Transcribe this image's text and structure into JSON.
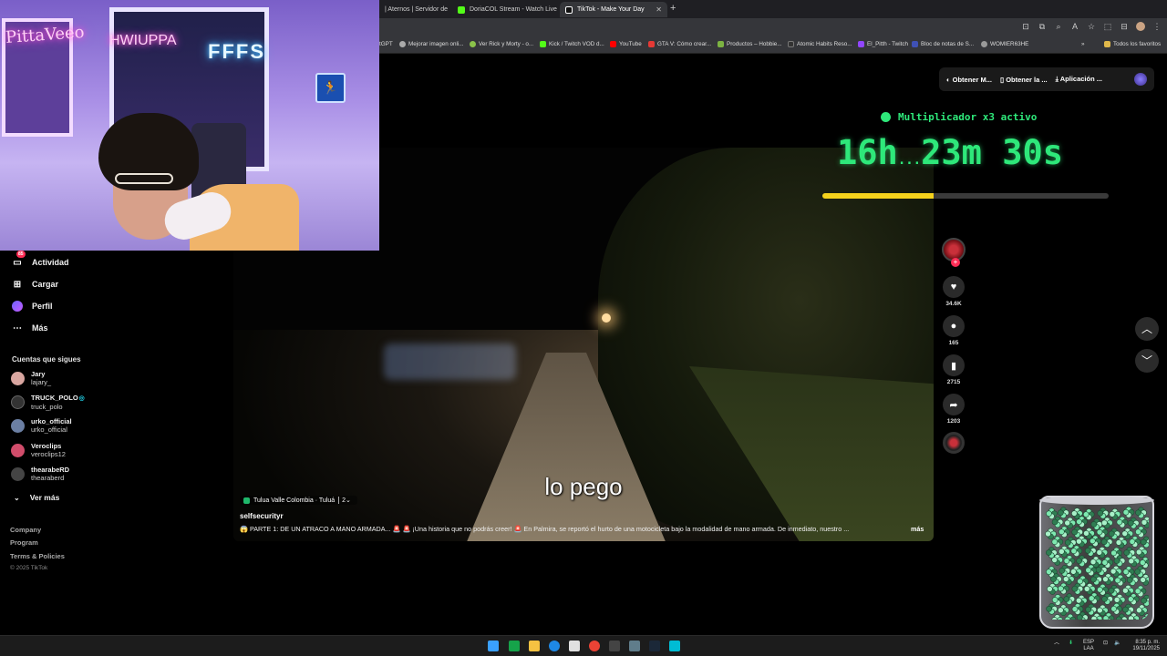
{
  "browser": {
    "tabs": [
      {
        "label": "| Aternos | Servidor de",
        "color": "#2c7be5",
        "active": false
      },
      {
        "label": "DoriaCOL Stream - Watch Live",
        "color": "#53fc18",
        "active": false
      },
      {
        "label": "TikTok - Make Your Day",
        "color": "#111111",
        "active": true
      }
    ],
    "new_tab": "+",
    "bookmarks": [
      {
        "label": "tGPT",
        "color": "#777777"
      },
      {
        "label": "Mejorar imagen onli...",
        "color": "#aaaaaa"
      },
      {
        "label": "Ver Rick y Morty - o...",
        "color": "#8bc34a"
      },
      {
        "label": "Kick / Twitch VOD d...",
        "color": "#53fc18"
      },
      {
        "label": "YouTube",
        "color": "#ff0000"
      },
      {
        "label": "GTA V: Cómo crear...",
        "color": "#e53935"
      },
      {
        "label": "Productos – Hobbie...",
        "color": "#7cb342"
      },
      {
        "label": "Atomic Habits Reso...",
        "color": "#333333"
      },
      {
        "label": "El_Pitth - Twitch",
        "color": "#9146ff"
      },
      {
        "label": "Bloc de notas de S...",
        "color": "#3f51b5"
      },
      {
        "label": "WOMIER63HE",
        "color": "#999999"
      },
      {
        "label": "Todos los favoritos",
        "color": "#e0b84b"
      }
    ]
  },
  "webcam": {
    "neon_left": "PittaVeeo",
    "neon_mid": "HWIUPPA",
    "neon_blue": "FFFS"
  },
  "sidebar": {
    "nav": [
      {
        "label": "Actividad",
        "icon": "activity-icon",
        "badge": "85"
      },
      {
        "label": "Cargar",
        "icon": "upload-icon"
      },
      {
        "label": "Perfil",
        "icon": "profile-icon"
      },
      {
        "label": "Más",
        "icon": "more-icon"
      }
    ],
    "following_title": "Cuentas que sigues",
    "following": [
      {
        "name": "Jary",
        "handle": "lajary_",
        "color": "#d9a6a0"
      },
      {
        "name": "TRUCK_POLO",
        "handle": "truck_polo",
        "color": "#333333",
        "verified": true
      },
      {
        "name": "urko_official",
        "handle": "urko_official",
        "color": "#6b7fa3"
      },
      {
        "name": "Veroclips",
        "handle": "veroclips12",
        "color": "#d14d6b"
      },
      {
        "name": "thearabeRD",
        "handle": "thearaberd",
        "color": "#444444"
      }
    ],
    "see_more": "Ver más",
    "footer": [
      "Company",
      "Program",
      "Terms & Policies"
    ],
    "copyright": "© 2025 TikTok"
  },
  "video": {
    "subtitle": "lo pego",
    "location": "Tulua Valle Colombia · Tuluá",
    "location_count": "2",
    "author": "selfsecurityr",
    "description": "😱 PARTE 1: DE UN ATRACO A MANO ARMADA... 🚨 🚨 ¡Una historia que no podrás creer! 🚨 En Palmira, se reportó el hurto de una motocicleta bajo la modalidad de mano armada. De inmediato, nuestro ...",
    "more": "más"
  },
  "actions": {
    "likes": "34.6K",
    "comments": "165",
    "saves": "2715",
    "shares": "1203"
  },
  "app_bar": {
    "btn1": "Obtener M...",
    "btn2": "Obtener la ...",
    "btn3": "Aplicación ..."
  },
  "stream_overlay": {
    "multiplier": "Multiplicador x3 activo",
    "hours": "16h",
    "separator": "...",
    "minutes": "23m",
    "seconds": "30s",
    "progress": 0.39,
    "accent": "#2ee87a",
    "bar_color": "#f5d21c"
  },
  "taskbar": {
    "lang": "ESP",
    "lang2": "LAA",
    "time": "8:35 p. m.",
    "date": "19/11/2025"
  }
}
